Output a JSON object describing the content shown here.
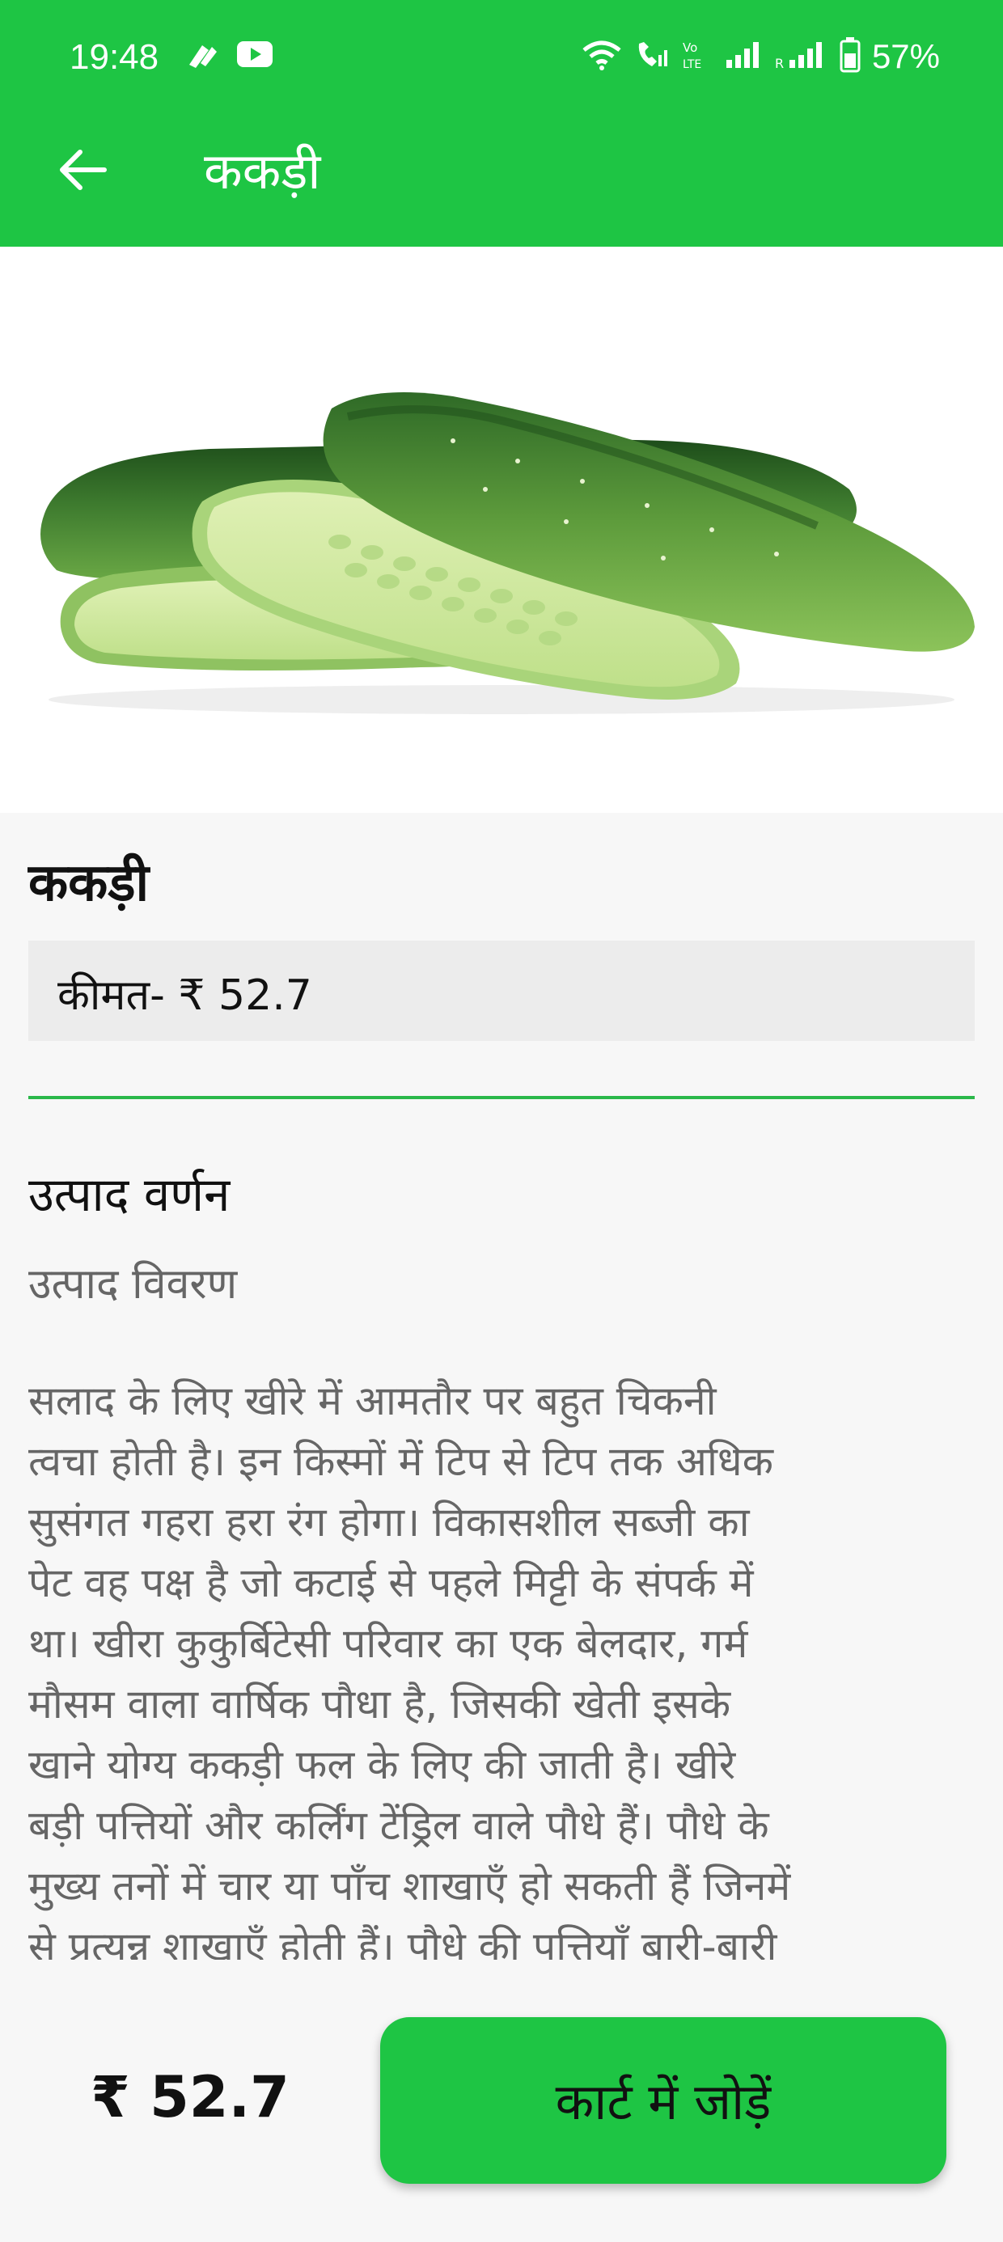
{
  "status_bar": {
    "time": "19:48",
    "battery": "57%",
    "icons": [
      "notification-icon",
      "youtube-icon",
      "wifi-icon",
      "wifi-call-icon",
      "volte-icon",
      "signal-icon",
      "signal-roaming-icon",
      "battery-icon"
    ]
  },
  "app_bar": {
    "back_icon": "arrow-left-icon",
    "title": "ककड़ी"
  },
  "product": {
    "image": "cucumber-image",
    "name": "ककड़ी",
    "price_label": "कीमत- ₹ 52.7",
    "description_title": "उत्पाद वर्णन",
    "description_subtitle": "उत्पाद विवरण",
    "description": " सलाद के लिए खीरे में आमतौर पर बहुत चिकनी\nत्वचा होती है। इन किस्मों में टिप से टिप तक अधिक\nसुसंगत गहरा हरा रंग होगा। विकासशील सब्जी का\nपेट वह पक्ष है जो कटाई से पहले मिट्टी के संपर्क में\nथा। खीरा कुकुर्बिटेसी परिवार का एक बेलदार, गर्म\nमौसम वाला वार्षिक पौधा है, जिसकी खेती इसके\nखाने योग्य ककड़ी फल के लिए की जाती है। खीरे\nबड़ी पत्तियों और कर्लिंग टेंड्रिल वाले पौधे हैं। पौधे के\nमुख्य तनों में चार या पाँच शाखाएँ हो सकती हैं जिनमें\nसे प्रत्यन्न शाखाएँ होती हैं। पौधे की पत्तियाँ बारी-बारी"
  },
  "bottom_bar": {
    "price": "₹ 52.7",
    "add_to_cart": "कार्ट में जोड़ें"
  },
  "colors": {
    "accent": "#1ec544",
    "divider": "#2bb84a",
    "price_box": "#ececec"
  }
}
